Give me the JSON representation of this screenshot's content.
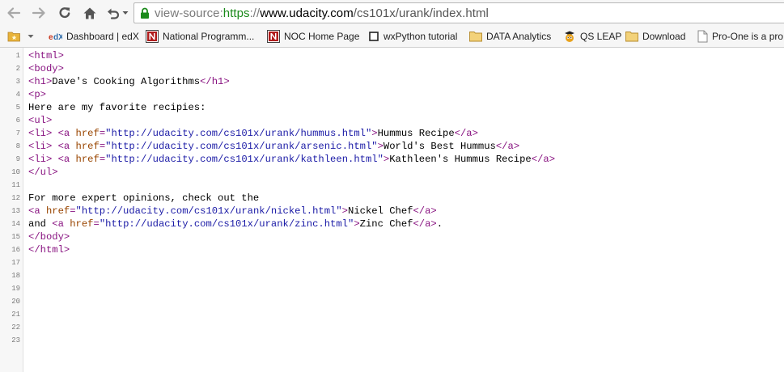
{
  "browser": {
    "url": {
      "scheme": "view-source:",
      "https": "https",
      "sep": "://",
      "host": "www.udacity.com",
      "path": "/cs101x/urank/index.html"
    },
    "bookmarks": [
      {
        "label": "Dashboard | edX",
        "icon": "edx-icon"
      },
      {
        "label": "National Programm...",
        "icon": "nptel-icon"
      },
      {
        "label": "NOC Home Page",
        "icon": "nptel-icon"
      },
      {
        "label": "wxPython tutorial",
        "icon": "page-icon"
      },
      {
        "label": "DATA Analytics",
        "icon": "folder-icon"
      },
      {
        "label": "QS LEAP",
        "icon": "qs-icon"
      },
      {
        "label": "Download",
        "icon": "folder-icon"
      },
      {
        "label": "Pro-One is a pro",
        "icon": "page-icon"
      }
    ]
  },
  "source": {
    "line_numbers": [
      "1",
      "2",
      "3",
      "4",
      "5",
      "6",
      "7",
      "8",
      "9",
      "10",
      "11",
      "12",
      "13",
      "14",
      "15",
      "16",
      "17",
      "18",
      "19",
      "20",
      "21",
      "22",
      "23"
    ],
    "lines": [
      [
        {
          "t": "tag",
          "v": "<html>"
        }
      ],
      [
        {
          "t": "tag",
          "v": "<body>"
        }
      ],
      [
        {
          "t": "tag",
          "v": "<h1>"
        },
        {
          "t": "txt",
          "v": "Dave's Cooking Algorithms"
        },
        {
          "t": "tag",
          "v": "</h1>"
        }
      ],
      [
        {
          "t": "tag",
          "v": "<p>"
        }
      ],
      [
        {
          "t": "txt",
          "v": "Here are my favorite recipies:"
        }
      ],
      [
        {
          "t": "tag",
          "v": "<ul>"
        }
      ],
      [
        {
          "t": "tag",
          "v": "<li>"
        },
        {
          "t": "txt",
          "v": " "
        },
        {
          "t": "tag",
          "v": "<a "
        },
        {
          "t": "attr",
          "v": "href"
        },
        {
          "t": "tag",
          "v": "="
        },
        {
          "t": "val",
          "v": "\"http://udacity.com/cs101x/urank/hummus.html\""
        },
        {
          "t": "tag",
          "v": ">"
        },
        {
          "t": "txt",
          "v": "Hummus Recipe"
        },
        {
          "t": "tag",
          "v": "</a>"
        }
      ],
      [
        {
          "t": "tag",
          "v": "<li>"
        },
        {
          "t": "txt",
          "v": " "
        },
        {
          "t": "tag",
          "v": "<a "
        },
        {
          "t": "attr",
          "v": "href"
        },
        {
          "t": "tag",
          "v": "="
        },
        {
          "t": "val",
          "v": "\"http://udacity.com/cs101x/urank/arsenic.html\""
        },
        {
          "t": "tag",
          "v": ">"
        },
        {
          "t": "txt",
          "v": "World's Best Hummus"
        },
        {
          "t": "tag",
          "v": "</a>"
        }
      ],
      [
        {
          "t": "tag",
          "v": "<li>"
        },
        {
          "t": "txt",
          "v": " "
        },
        {
          "t": "tag",
          "v": "<a "
        },
        {
          "t": "attr",
          "v": "href"
        },
        {
          "t": "tag",
          "v": "="
        },
        {
          "t": "val",
          "v": "\"http://udacity.com/cs101x/urank/kathleen.html\""
        },
        {
          "t": "tag",
          "v": ">"
        },
        {
          "t": "txt",
          "v": "Kathleen's Hummus Recipe"
        },
        {
          "t": "tag",
          "v": "</a>"
        }
      ],
      [
        {
          "t": "tag",
          "v": "</ul>"
        }
      ],
      [],
      [
        {
          "t": "txt",
          "v": "For more expert opinions, check out the"
        }
      ],
      [
        {
          "t": "tag",
          "v": "<a "
        },
        {
          "t": "attr",
          "v": "href"
        },
        {
          "t": "tag",
          "v": "="
        },
        {
          "t": "val",
          "v": "\"http://udacity.com/cs101x/urank/nickel.html\""
        },
        {
          "t": "tag",
          "v": ">"
        },
        {
          "t": "txt",
          "v": "Nickel Chef"
        },
        {
          "t": "tag",
          "v": "</a>"
        }
      ],
      [
        {
          "t": "txt",
          "v": "and "
        },
        {
          "t": "tag",
          "v": "<a "
        },
        {
          "t": "attr",
          "v": "href"
        },
        {
          "t": "tag",
          "v": "="
        },
        {
          "t": "val",
          "v": "\"http://udacity.com/cs101x/urank/zinc.html\""
        },
        {
          "t": "tag",
          "v": ">"
        },
        {
          "t": "txt",
          "v": "Zinc Chef"
        },
        {
          "t": "tag",
          "v": "</a>"
        },
        {
          "t": "txt",
          "v": "."
        }
      ],
      [
        {
          "t": "tag",
          "v": "</body>"
        }
      ],
      [
        {
          "t": "tag",
          "v": "</html>"
        }
      ],
      [],
      [],
      [],
      [],
      [],
      [],
      []
    ]
  }
}
